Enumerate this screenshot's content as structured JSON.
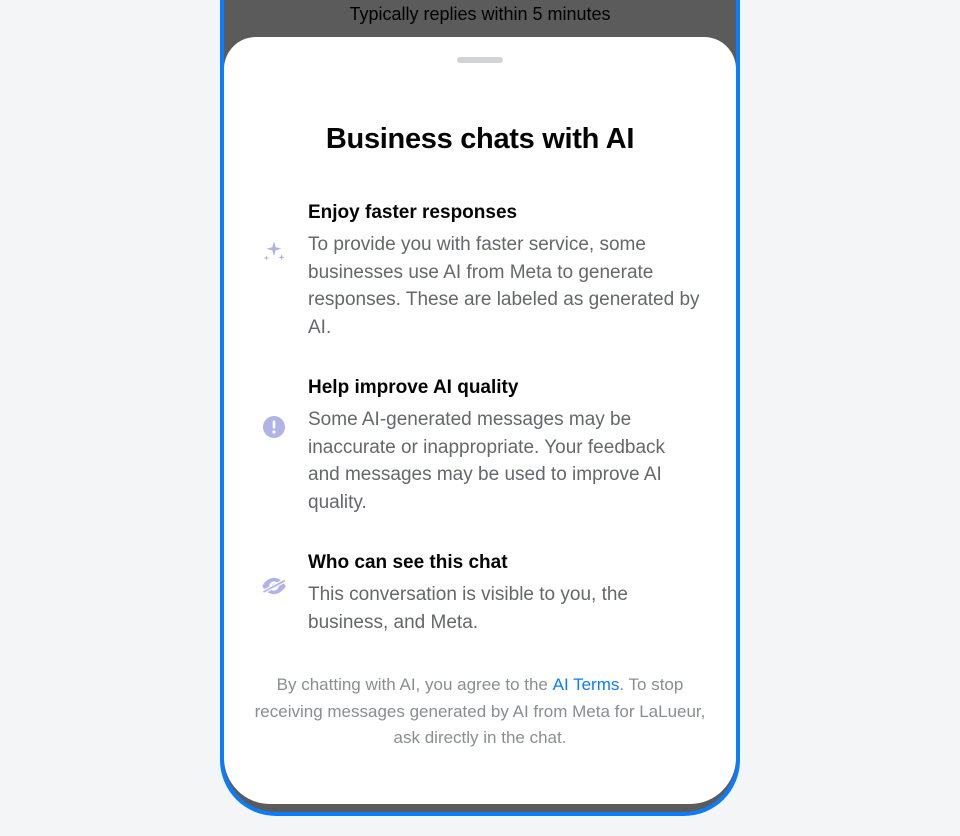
{
  "header": {
    "reply_time": "Typically replies within 5 minutes"
  },
  "sheet": {
    "title": "Business chats with AI",
    "items": [
      {
        "icon": "sparkle-icon",
        "title": "Enjoy faster responses",
        "desc": "To provide you with faster service, some businesses use AI from Meta to generate responses. These are labeled as generated by AI."
      },
      {
        "icon": "alert-icon",
        "title": "Help improve AI quality",
        "desc": "Some AI-generated messages may be inaccurate or inappropriate. Your feedback and messages may be used to improve AI quality."
      },
      {
        "icon": "eye-off-icon",
        "title": "Who can see this chat",
        "desc": "This conversation is visible to you, the business, and Meta."
      }
    ],
    "footer": {
      "prefix": "By chatting with AI, you agree to the ",
      "link": "AI Terms",
      "suffix": ". To stop receiving messages generated by AI from Meta for LaLueur, ask directly in the chat."
    }
  }
}
